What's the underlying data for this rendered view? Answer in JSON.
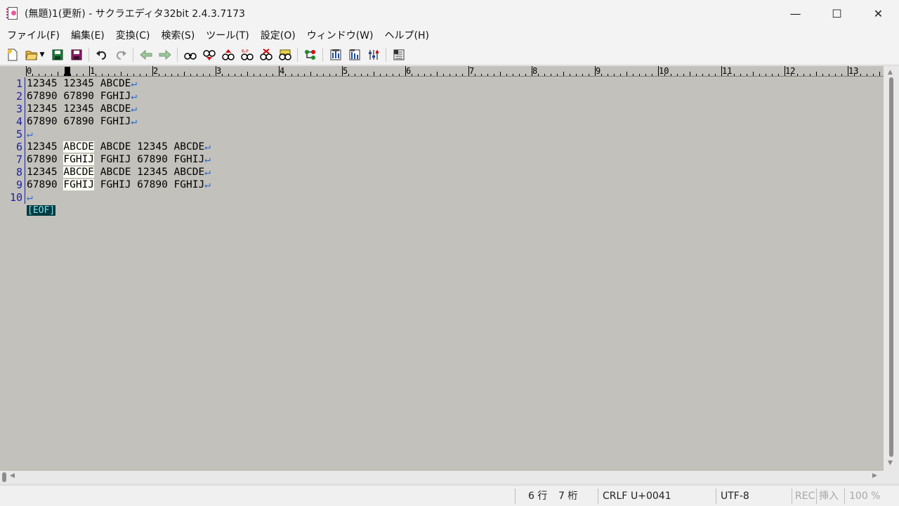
{
  "window": {
    "title": "(無題)1(更新) - サクラエディタ32bit 2.4.3.7173",
    "controls": {
      "minimize": "—",
      "maximize": "☐",
      "close": "✕"
    }
  },
  "menu": [
    "ファイル(F)",
    "編集(E)",
    "変換(C)",
    "検索(S)",
    "ツール(T)",
    "設定(O)",
    "ウィンドウ(W)",
    "ヘルプ(H)"
  ],
  "ruler": {
    "numbers": [
      "0",
      "1",
      "2",
      "3",
      "4",
      "5",
      "6",
      "7",
      "8",
      "9",
      "10",
      "11",
      "12",
      "13"
    ]
  },
  "editor": {
    "line_numbers": [
      "1",
      "2",
      "3",
      "4",
      "5",
      "6",
      "7",
      "8",
      "9",
      "10"
    ],
    "lines": [
      {
        "before": "12345 12345 ABCDE",
        "sel": "",
        "after": "",
        "eol": "↵"
      },
      {
        "before": "67890 67890 FGHIJ",
        "sel": "",
        "after": "",
        "eol": "↵"
      },
      {
        "before": "12345 12345 ABCDE",
        "sel": "",
        "after": "",
        "eol": "↵"
      },
      {
        "before": "67890 67890 FGHIJ",
        "sel": "",
        "after": "",
        "eol": "↵"
      },
      {
        "before": "",
        "sel": "",
        "after": "",
        "eol": "↵"
      },
      {
        "before": "12345 ",
        "sel": "ABCDE",
        "after": " ABCDE 12345 ABCDE",
        "eol": "↵"
      },
      {
        "before": "67890 ",
        "sel": "FGHIJ",
        "after": " FGHIJ 67890 FGHIJ",
        "eol": "↵"
      },
      {
        "before": "12345 ",
        "sel": "ABCDE",
        "after": " ABCDE 12345 ABCDE",
        "eol": "↵"
      },
      {
        "before": "67890 ",
        "sel": "FGHIJ",
        "after": " FGHIJ 67890 FGHIJ",
        "eol": "↵"
      },
      {
        "before": "",
        "sel": "",
        "after": "",
        "eol": "↵"
      }
    ],
    "eof_marker": "[EOF]"
  },
  "status": {
    "row": "6 行",
    "col": "7 桁",
    "eol": "CRLF",
    "codepoint": "U+0041",
    "encoding": "UTF-8",
    "rec": "REC",
    "insert": "挿入",
    "zoom": "100 %"
  },
  "colors": {
    "editor_bg": "#c3c1bb",
    "selection_bg": "#fffff6",
    "line_number": "#1b22a8",
    "eol_mark": "#2a6bd0",
    "eof_bg": "#003a42",
    "eof_fg": "#7fe3e8"
  },
  "toolbar_icons": [
    "new-file-icon",
    "open-file-icon",
    "save-icon",
    "save-all-icon",
    "undo-icon",
    "redo-icon",
    "move-back-icon",
    "move-forward-icon",
    "search-icon",
    "search-next-icon",
    "search-prev-icon",
    "replace-icon",
    "clear-search-icon",
    "grep-icon",
    "outline-icon",
    "compare-icon",
    "settings-icon",
    "font-settings-icon",
    "window-list-icon"
  ]
}
